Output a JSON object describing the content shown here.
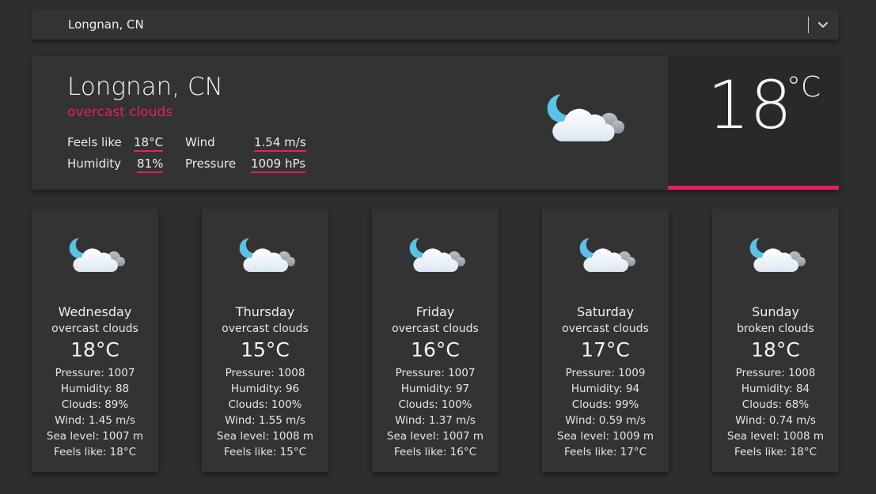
{
  "selector": {
    "value": "Longnan, CN",
    "chevron_icon": "chevron-down-icon"
  },
  "current": {
    "city": "Longnan, CN",
    "description": "overcast clouds",
    "feels_like_label": "Feels like",
    "feels_like_value": "18°C",
    "wind_label": "Wind",
    "wind_value": "1.54 m/s",
    "humidity_label": "Humidity",
    "humidity_value": "81%",
    "pressure_label": "Pressure",
    "pressure_value": "1009 hPs",
    "temperature": "18",
    "unit": "°C",
    "icon": "night-cloudy-icon"
  },
  "forecast": [
    {
      "day": "Wednesday",
      "description": "overcast clouds",
      "temp": "18°C",
      "pressure": "Pressure: 1007",
      "humidity": "Humidity: 88",
      "clouds": "Clouds: 89%",
      "wind": "Wind: 1.45 m/s",
      "sea_level": "Sea level: 1007 m",
      "feels_like": "Feels like: 18°C"
    },
    {
      "day": "Thursday",
      "description": "overcast clouds",
      "temp": "15°C",
      "pressure": "Pressure: 1008",
      "humidity": "Humidity: 96",
      "clouds": "Clouds: 100%",
      "wind": "Wind: 1.55 m/s",
      "sea_level": "Sea level: 1008 m",
      "feels_like": "Feels like: 15°C"
    },
    {
      "day": "Friday",
      "description": "overcast clouds",
      "temp": "16°C",
      "pressure": "Pressure: 1007",
      "humidity": "Humidity: 97",
      "clouds": "Clouds: 100%",
      "wind": "Wind: 1.37 m/s",
      "sea_level": "Sea level: 1007 m",
      "feels_like": "Feels like: 16°C"
    },
    {
      "day": "Saturday",
      "description": "overcast clouds",
      "temp": "17°C",
      "pressure": "Pressure: 1009",
      "humidity": "Humidity: 94",
      "clouds": "Clouds: 99%",
      "wind": "Wind: 0.59 m/s",
      "sea_level": "Sea level: 1009 m",
      "feels_like": "Feels like: 17°C"
    },
    {
      "day": "Sunday",
      "description": "broken clouds",
      "temp": "18°C",
      "pressure": "Pressure: 1008",
      "humidity": "Humidity: 84",
      "clouds": "Clouds: 68%",
      "wind": "Wind: 0.74 m/s",
      "sea_level": "Sea level: 1008 m",
      "feels_like": "Feels like: 18°C"
    }
  ],
  "colors": {
    "accent": "#e91e63",
    "background": "#2e2e2e",
    "panel": "#333333",
    "temp_box": "#292929",
    "moon": "#5bc0e6"
  }
}
